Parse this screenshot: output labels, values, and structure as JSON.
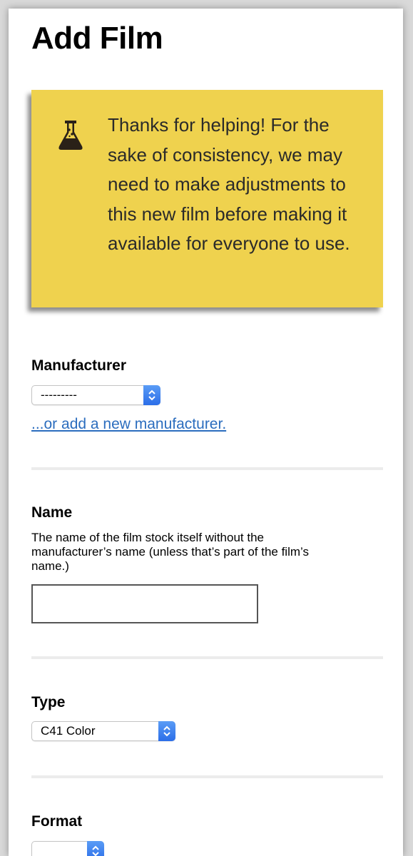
{
  "page": {
    "title": "Add Film"
  },
  "notice": {
    "icon": "flask-icon",
    "text": "Thanks for helping! For the sake of consistency, we may need to make adjustments to this new film before making it available for everyone to use.",
    "background_color": "#efd24e"
  },
  "manufacturer": {
    "label": "Manufacturer",
    "selected": "---------",
    "add_link": "...or add a new manufacturer."
  },
  "name": {
    "label": "Name",
    "help": "The name of the film stock itself without the manufacturer’s name (unless that’s part of the film’s name.)",
    "value": ""
  },
  "type": {
    "label": "Type",
    "selected": "C41 Color"
  },
  "format": {
    "label": "Format",
    "selected": ""
  },
  "colors": {
    "link": "#2b6dbe",
    "select_accent": "#3b82f0"
  }
}
